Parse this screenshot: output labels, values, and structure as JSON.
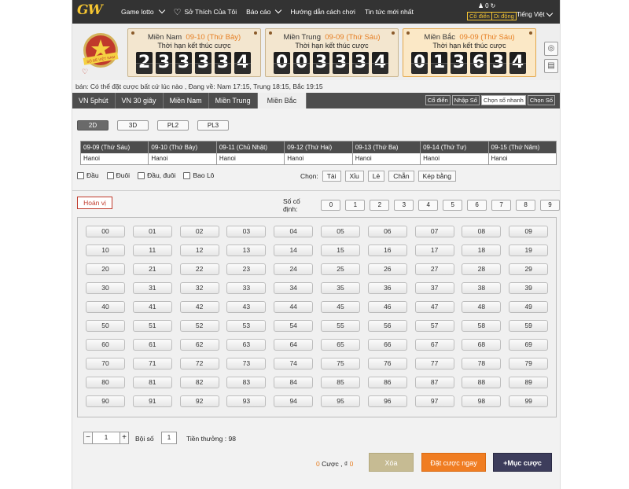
{
  "nav": {
    "logo": "GW",
    "items": [
      {
        "label": "Game lotto",
        "chev": true
      },
      {
        "label": "Sở Thích Của Tôi",
        "chev": false
      },
      {
        "label": "Báo cáo",
        "chev": true
      },
      {
        "label": "Hướng dẫn cách chơi",
        "chev": false
      },
      {
        "label": "Tin tức mới nhất",
        "chev": false
      }
    ],
    "balance": "0",
    "mode_classic": "Cổ điển",
    "mode_mobile": "Di động",
    "language": "Tiếng Việt"
  },
  "draws": [
    {
      "region": "Miền Nam",
      "date": "09-10 (Thứ Bảy)",
      "subtitle": "Thời hạn kết thúc cược",
      "digits": [
        "2",
        "3",
        "3",
        "3",
        "3",
        "4"
      ]
    },
    {
      "region": "Miền Trung",
      "date": "09-09 (Thứ Sáu)",
      "subtitle": "Thời hạn kết thúc cược",
      "digits": [
        "0",
        "0",
        "3",
        "3",
        "3",
        "4"
      ]
    },
    {
      "region": "Miền Bắc",
      "date": "09-09 (Thứ Sáu)",
      "subtitle": "Thời hạn kết thúc cược",
      "digits": [
        "0",
        "1",
        "3",
        "6",
        "3",
        "4"
      ]
    }
  ],
  "emblem_text": "SỐ ĐỀ VIỆT NAM",
  "marquee": "bán: Có thể đặt cược bất cứ lúc nào ,  Đang về: Nam 17:15, Trung 18:15, Bắc 19:15",
  "tabs": [
    "VN 5phút",
    "VN 30 giây",
    "Miền Nam",
    "Miền Trung",
    "Miền Bắc"
  ],
  "active_tab": "Miền Bắc",
  "modes": [
    "Cổ điển",
    "Nhập Số",
    "Chọn số nhanh",
    "Chọn Số"
  ],
  "subtabs": [
    "2D",
    "3D",
    "PL2",
    "PL3"
  ],
  "dates": {
    "headers": [
      "09-09 (Thứ Sáu)",
      "09-10 (Thứ Bảy)",
      "09-11 (Chủ Nhật)",
      "09-12 (Thứ Hai)",
      "09-13 (Thứ Ba)",
      "09-14 (Thứ Tư)",
      "09-15 (Thứ Năm)"
    ],
    "values": [
      "Hanoi",
      "Hanoi",
      "Hanoi",
      "Hanoi",
      "Hanoi",
      "Hanoi",
      "Hanoi"
    ]
  },
  "filters": [
    "Đầu",
    "Đuôi",
    "Đầu, đuôi",
    "Bao Lô"
  ],
  "chon": {
    "label": "Chọn:",
    "buttons": [
      "Tài",
      "Xỉu",
      "Lẻ",
      "Chẵn",
      "Kép bằng"
    ]
  },
  "hoan_vi": "Hoán vị",
  "co_dinh": {
    "label": "Số cố định:",
    "digits": [
      "0",
      "1",
      "2",
      "3",
      "4",
      "5",
      "6",
      "7",
      "8",
      "9"
    ]
  },
  "numbers": [
    "00",
    "01",
    "02",
    "03",
    "04",
    "05",
    "06",
    "07",
    "08",
    "09",
    "10",
    "11",
    "12",
    "13",
    "14",
    "15",
    "16",
    "17",
    "18",
    "19",
    "20",
    "21",
    "22",
    "23",
    "24",
    "25",
    "26",
    "27",
    "28",
    "29",
    "30",
    "31",
    "32",
    "33",
    "34",
    "35",
    "36",
    "37",
    "38",
    "39",
    "40",
    "41",
    "42",
    "43",
    "44",
    "45",
    "46",
    "47",
    "48",
    "49",
    "50",
    "51",
    "52",
    "53",
    "54",
    "55",
    "56",
    "57",
    "58",
    "59",
    "60",
    "61",
    "62",
    "63",
    "64",
    "65",
    "66",
    "67",
    "68",
    "69",
    "70",
    "71",
    "72",
    "73",
    "74",
    "75",
    "76",
    "77",
    "78",
    "79",
    "80",
    "81",
    "82",
    "83",
    "84",
    "85",
    "86",
    "87",
    "88",
    "89",
    "90",
    "91",
    "92",
    "93",
    "94",
    "95",
    "96",
    "97",
    "98",
    "99"
  ],
  "footer": {
    "stepper_value": "1",
    "boi_so_label": "Bội số",
    "boi_so_value": "1",
    "tien_thuong": "Tiền thưởng :  98",
    "cuoc_count": "0",
    "cuoc_label": "Cược ,",
    "cuoc_currency": "₫",
    "cuoc_amount": "0",
    "xoa": "Xóa",
    "dat_cuoc": "Đặt cược ngay",
    "muc_cuoc": "Mục cược"
  }
}
